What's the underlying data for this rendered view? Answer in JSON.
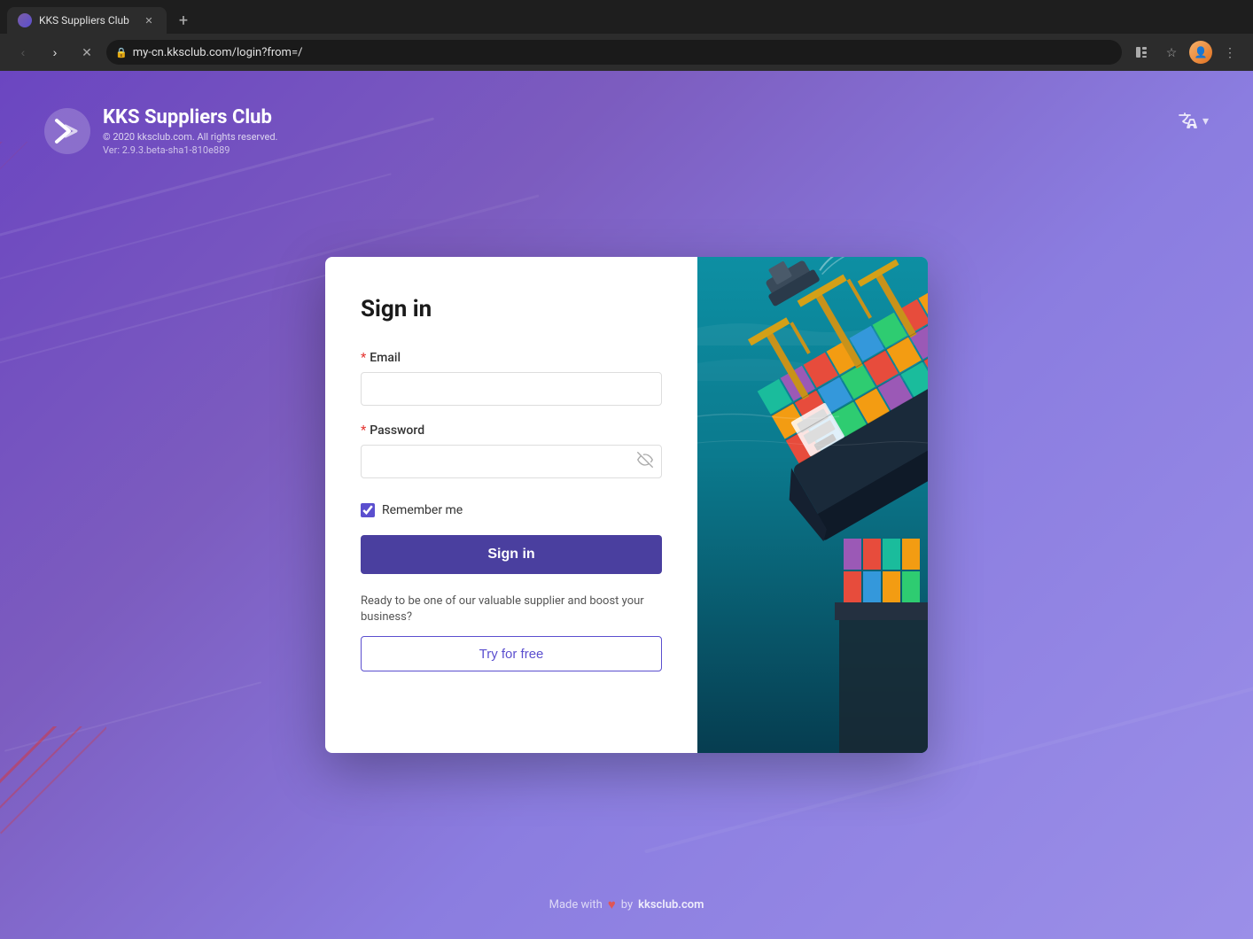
{
  "browser": {
    "tab_title": "KKS Suppliers Club",
    "url": "my-cn.kksclub.com/login?from=/",
    "tab_favicon": "K",
    "new_tab_label": "+",
    "back_label": "‹",
    "forward_label": "›",
    "refresh_label": "✕",
    "home_label": "⌂"
  },
  "page": {
    "background_gradient_start": "#6b46c1",
    "background_gradient_end": "#9b8fe8"
  },
  "logo": {
    "icon": "K",
    "title": "KKS Suppliers Club",
    "copyright": "© 2020 kksclub.com. All rights reserved.",
    "version": "Ver: 2.9.3.beta-sha1-810e889"
  },
  "translate_btn": {
    "icon": "🔤",
    "arrow": "▾"
  },
  "form": {
    "title": "Sign in",
    "email_label": "Email",
    "email_placeholder": "",
    "password_label": "Password",
    "password_placeholder": "",
    "remember_me_label": "Remember me",
    "sign_in_btn": "Sign in",
    "cta_text": "Ready to be one of our valuable supplier and boost your business?",
    "try_free_btn": "Try for free"
  },
  "footer": {
    "made_with": "Made with",
    "heart": "♥",
    "by": "by",
    "brand": "kksclub.com"
  }
}
